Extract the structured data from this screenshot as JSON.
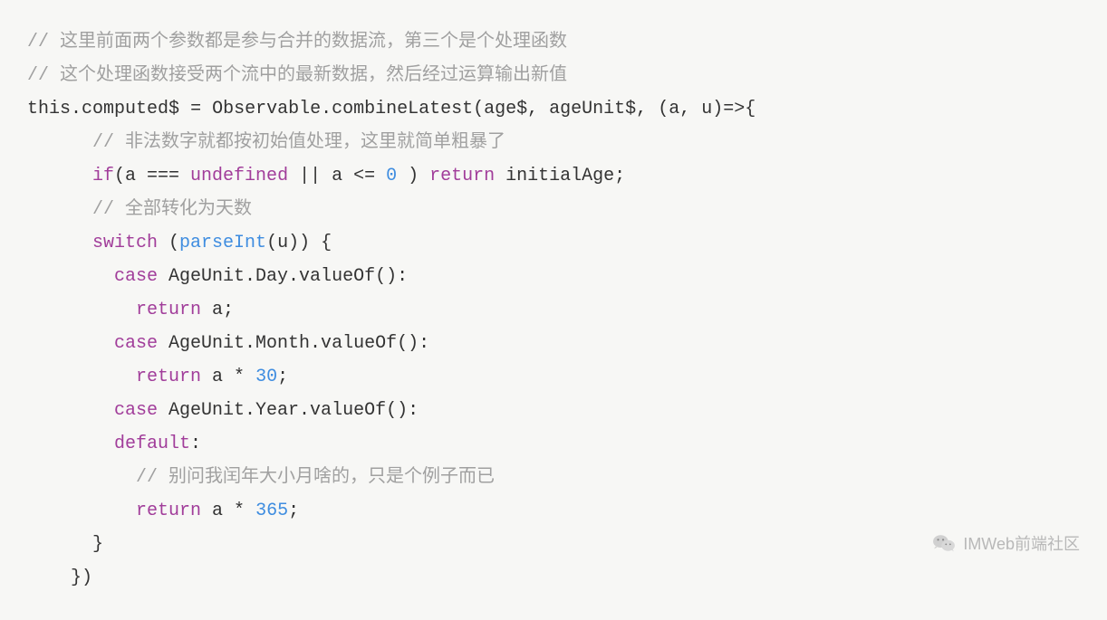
{
  "code": {
    "line1_comment": "// 这里前面两个参数都是参与合并的数据流，第三个是个处理函数",
    "line2_comment": "// 这个处理函数接受两个流中的最新数据，然后经过运算输出新值",
    "line3_this": "this",
    "line3_dot1": ".",
    "line3_computed": "computed$",
    "line3_eq": " = ",
    "line3_observable": "Observable",
    "line3_dot2": ".",
    "line3_combine": "combineLatest",
    "line3_args": "(age$, ageUnit$, (a, u)=>{",
    "line4_comment": "      // 非法数字就都按初始值处理，这里就简单粗暴了",
    "line5_if": "if",
    "line5_cond1": "(a === ",
    "line5_undefined": "undefined",
    "line5_cond2": " || a <= ",
    "line5_zero": "0",
    "line5_cond3": " ) ",
    "line5_return": "return",
    "line5_initial": " initialAge;",
    "line6_comment": "      // 全部转化为天数",
    "line7_switch": "switch",
    "line7_open": " (",
    "line7_parseInt": "parseInt",
    "line7_close": "(u)) {",
    "line8_case": "case",
    "line8_val": " AgeUnit.Day.valueOf():",
    "line9_return": "return",
    "line9_val": " a;",
    "line10_case": "case",
    "line10_val": " AgeUnit.Month.valueOf():",
    "line11_return": "return",
    "line11_a": " a * ",
    "line11_num": "30",
    "line11_semi": ";",
    "line12_case": "case",
    "line12_val": " AgeUnit.Year.valueOf():",
    "line13_default": "default",
    "line13_colon": ":",
    "line14_comment": "          // 别问我闰年大小月啥的，只是个例子而已",
    "line15_return": "return",
    "line15_a": " a * ",
    "line15_num": "365",
    "line15_semi": ";",
    "line16_close": "      }",
    "line17_close": "    })"
  },
  "watermark": {
    "text": "IMWeb前端社区"
  }
}
